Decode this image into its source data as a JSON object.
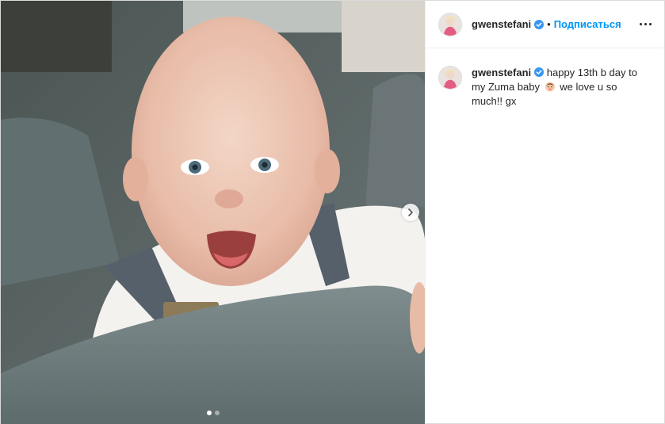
{
  "post": {
    "author": {
      "username": "gwenstefani",
      "verified": true,
      "follow_label": "Подписаться",
      "separator": "•"
    },
    "caption": {
      "text_before_emoji": "happy 13th b day to my Zuma baby",
      "emoji": "baby-face-emoji",
      "text_after_emoji": "we love u so much!! gx"
    },
    "carousel": {
      "current_index": 1,
      "total": 2
    }
  },
  "icons": {
    "verified": "verified-badge-icon",
    "more": "more-options-icon",
    "next": "chevron-right-icon"
  },
  "colors": {
    "link_blue": "#0095f6",
    "text": "#262626",
    "border": "#dbdbdb",
    "verified_blue": "#3897f0"
  }
}
